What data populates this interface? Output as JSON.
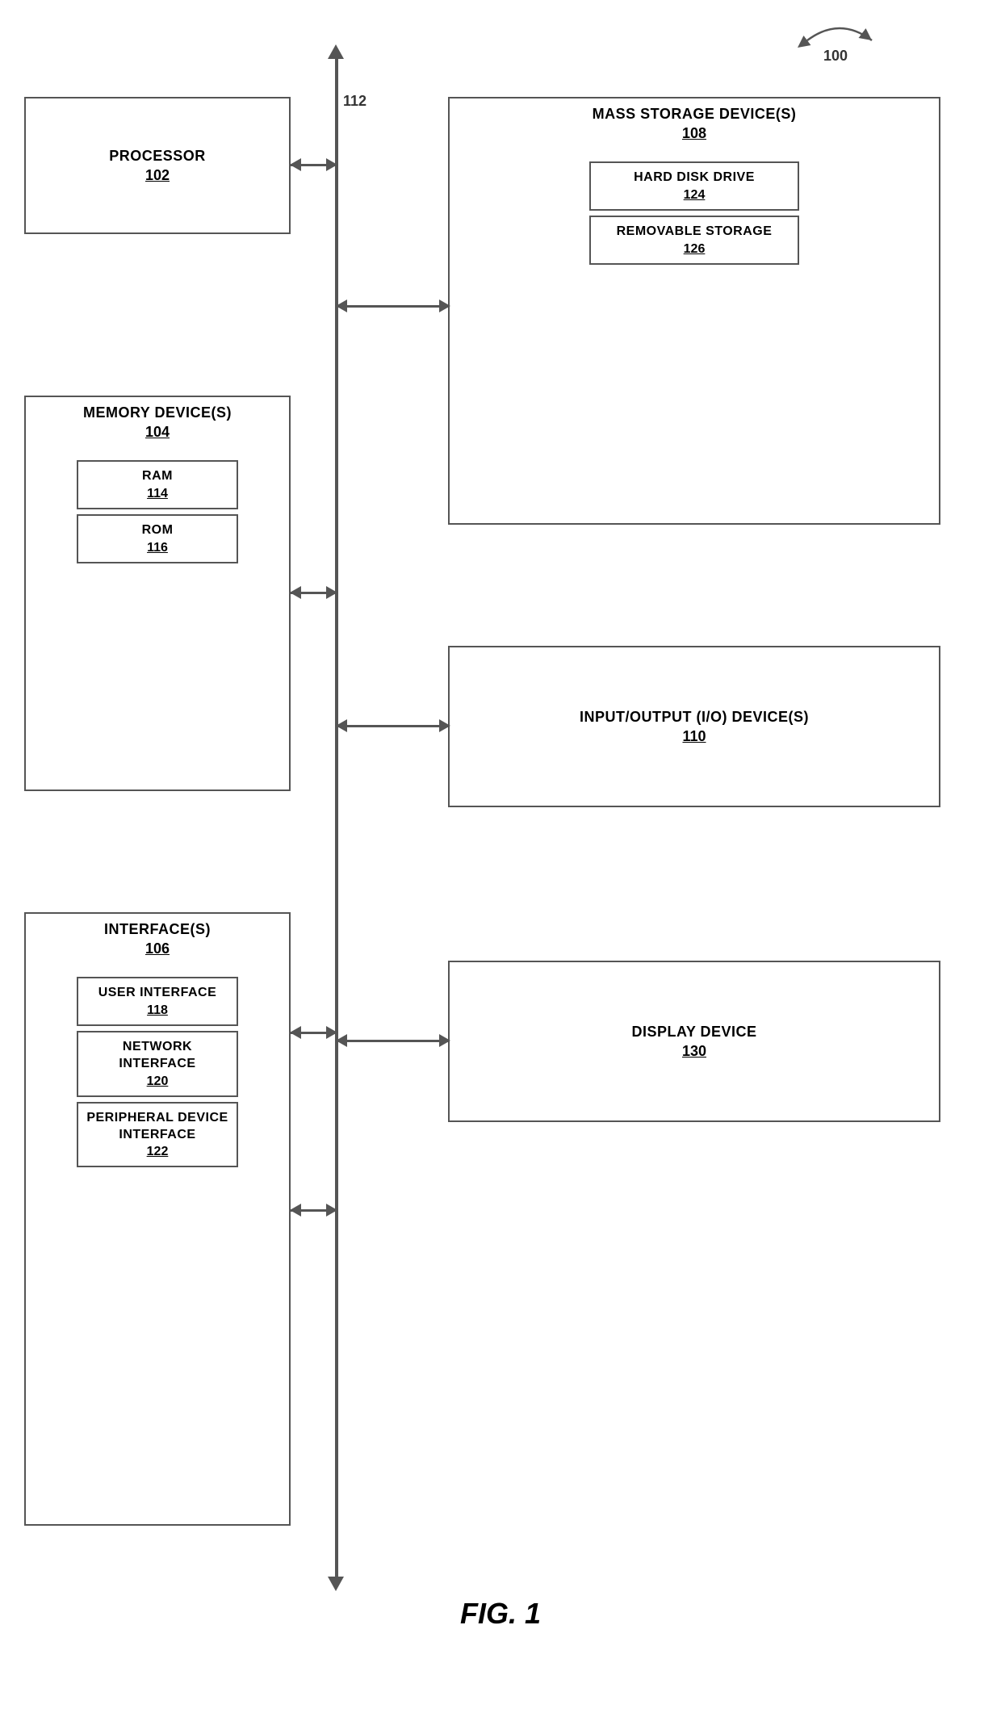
{
  "diagram": {
    "title": "FIG. 1",
    "ref_100": "100",
    "bus_label": "112",
    "processor": {
      "label": "PROCESSOR",
      "number": "102"
    },
    "memory_devices": {
      "label": "MEMORY DEVICE(S)",
      "number": "104",
      "ram": {
        "label": "RAM",
        "number": "114"
      },
      "rom": {
        "label": "ROM",
        "number": "116"
      }
    },
    "interfaces": {
      "label": "INTERFACE(S)",
      "number": "106",
      "user_interface": {
        "label": "USER INTERFACE",
        "number": "118"
      },
      "network_interface": {
        "label": "NETWORK INTERFACE",
        "number": "120"
      },
      "peripheral_device_interface": {
        "label": "PERIPHERAL DEVICE INTERFACE",
        "number": "122"
      }
    },
    "mass_storage": {
      "label": "MASS STORAGE DEVICE(S)",
      "number": "108",
      "hard_disk": {
        "label": "HARD DISK DRIVE",
        "number": "124"
      },
      "removable_storage": {
        "label": "REMOVABLE STORAGE",
        "number": "126"
      }
    },
    "io_devices": {
      "label": "INPUT/OUTPUT (I/O) DEVICE(S)",
      "number": "110"
    },
    "display_device": {
      "label": "DISPLAY DEVICE",
      "number": "130"
    }
  }
}
